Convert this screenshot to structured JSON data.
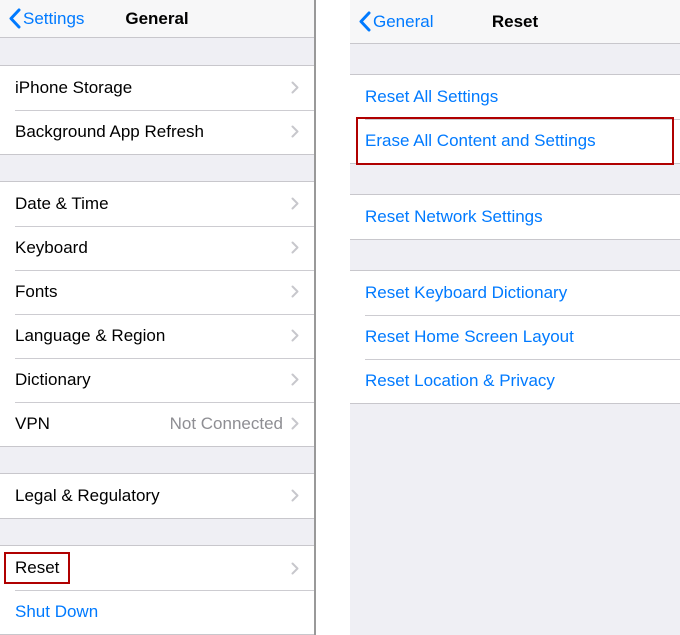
{
  "left": {
    "back_label": "Settings",
    "title": "General",
    "group1": [
      {
        "label": "iPhone Storage"
      },
      {
        "label": "Background App Refresh"
      }
    ],
    "group2": [
      {
        "label": "Date & Time"
      },
      {
        "label": "Keyboard"
      },
      {
        "label": "Fonts"
      },
      {
        "label": "Language & Region"
      },
      {
        "label": "Dictionary"
      },
      {
        "label": "VPN",
        "value": "Not Connected"
      }
    ],
    "group3": [
      {
        "label": "Legal & Regulatory"
      }
    ],
    "group4": [
      {
        "label": "Reset"
      },
      {
        "label": "Shut Down"
      }
    ]
  },
  "right": {
    "back_label": "General",
    "title": "Reset",
    "group1": [
      {
        "label": "Reset All Settings"
      },
      {
        "label": "Erase All Content and Settings"
      }
    ],
    "group2": [
      {
        "label": "Reset Network Settings"
      }
    ],
    "group3": [
      {
        "label": "Reset Keyboard Dictionary"
      },
      {
        "label": "Reset Home Screen Layout"
      },
      {
        "label": "Reset Location & Privacy"
      }
    ]
  }
}
